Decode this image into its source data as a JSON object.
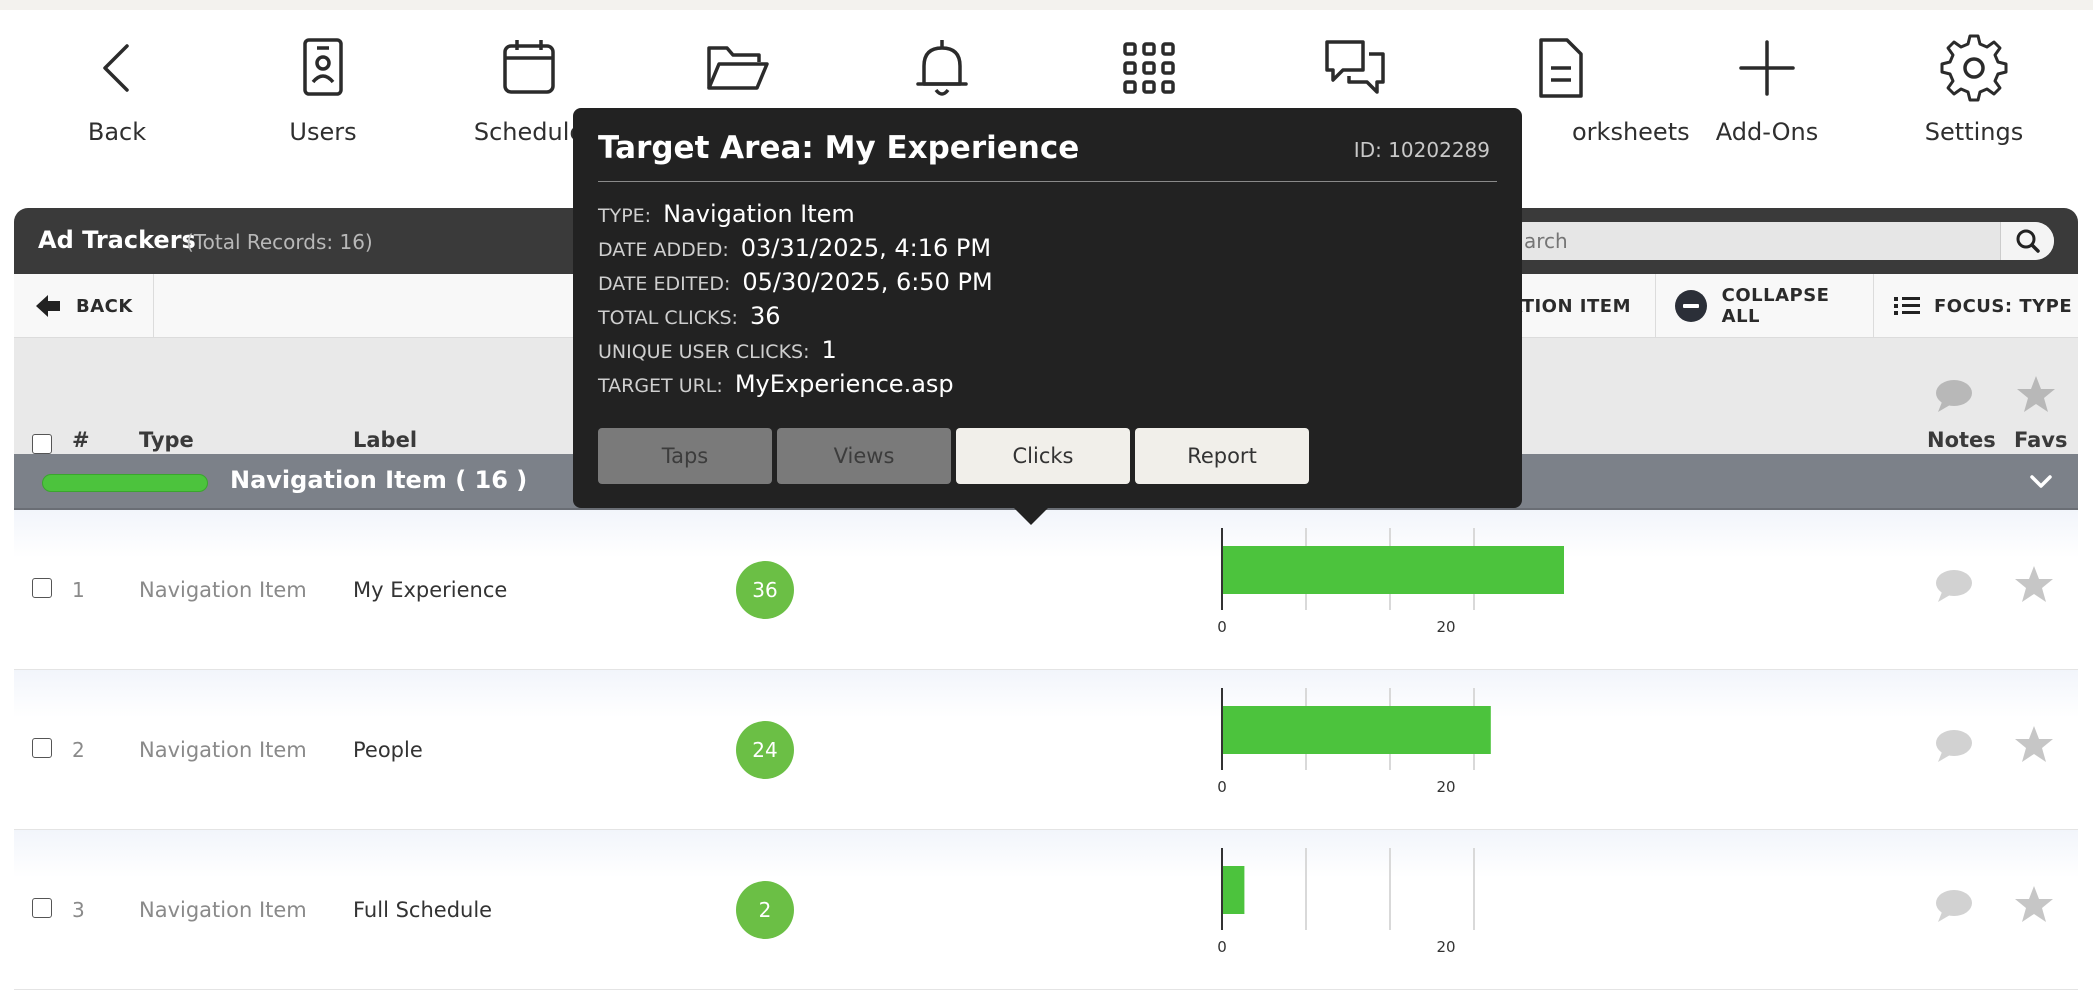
{
  "toolbar": {
    "items": [
      {
        "label": "Back",
        "icon": "chevron-left-icon"
      },
      {
        "label": "Users",
        "icon": "id-badge-icon"
      },
      {
        "label": "Schedule",
        "icon": "calendar-icon"
      },
      {
        "label": "",
        "icon": "folder-open-icon"
      },
      {
        "label": "",
        "icon": "bell-icon"
      },
      {
        "label": "",
        "icon": "grid-icon"
      },
      {
        "label": "",
        "icon": "chat-bubbles-icon"
      },
      {
        "label": "orksheets",
        "icon": "document-icon"
      },
      {
        "label": "Add-Ons",
        "icon": "plus-icon"
      },
      {
        "label": "Settings",
        "icon": "gear-icon"
      }
    ]
  },
  "panel": {
    "title": "Ad Trackers",
    "record_count": "(Total Records: 16)",
    "search_placeholder": "arch"
  },
  "actions": {
    "back": "BACK",
    "nav_item": "GATION ITEM",
    "collapse_all": "COLLAPSE ALL",
    "focus_type": "FOCUS: TYPE"
  },
  "columns": {
    "num": "#",
    "type": "Type",
    "label": "Label",
    "notes": "Notes",
    "favs": "Favs"
  },
  "group": {
    "title": "Navigation Item   ( 16 )",
    "accent": "#4cc33d"
  },
  "rows": [
    {
      "num": "1",
      "type": "Navigation Item",
      "label": "My Experience",
      "clicks": "36"
    },
    {
      "num": "2",
      "type": "Navigation Item",
      "label": "People",
      "clicks": "24"
    },
    {
      "num": "3",
      "type": "Navigation Item",
      "label": "Full Schedule",
      "clicks": "2"
    }
  ],
  "chart_data": {
    "type": "bar",
    "orientation": "horizontal",
    "categories": [
      "My Experience",
      "People",
      "Full Schedule"
    ],
    "values": [
      36,
      24,
      2
    ],
    "xlim": [
      0,
      30
    ],
    "ticks": [
      "0",
      "20"
    ],
    "color": "#4cc33d"
  },
  "tooltip": {
    "title": "Target Area: My Experience",
    "id": "ID: 10202289",
    "fields": [
      {
        "key": "TYPE:",
        "value": "Navigation Item"
      },
      {
        "key": "DATE ADDED:",
        "value": "03/31/2025, 4:16 PM"
      },
      {
        "key": "DATE EDITED:",
        "value": "05/30/2025, 6:50 PM"
      },
      {
        "key": "TOTAL CLICKS:",
        "value": "36"
      },
      {
        "key": "UNIQUE USER CLICKS:",
        "value": "1"
      },
      {
        "key": "TARGET URL:",
        "value": "MyExperience.asp"
      }
    ],
    "buttons": [
      "Taps",
      "Views",
      "Clicks",
      "Report"
    ]
  }
}
